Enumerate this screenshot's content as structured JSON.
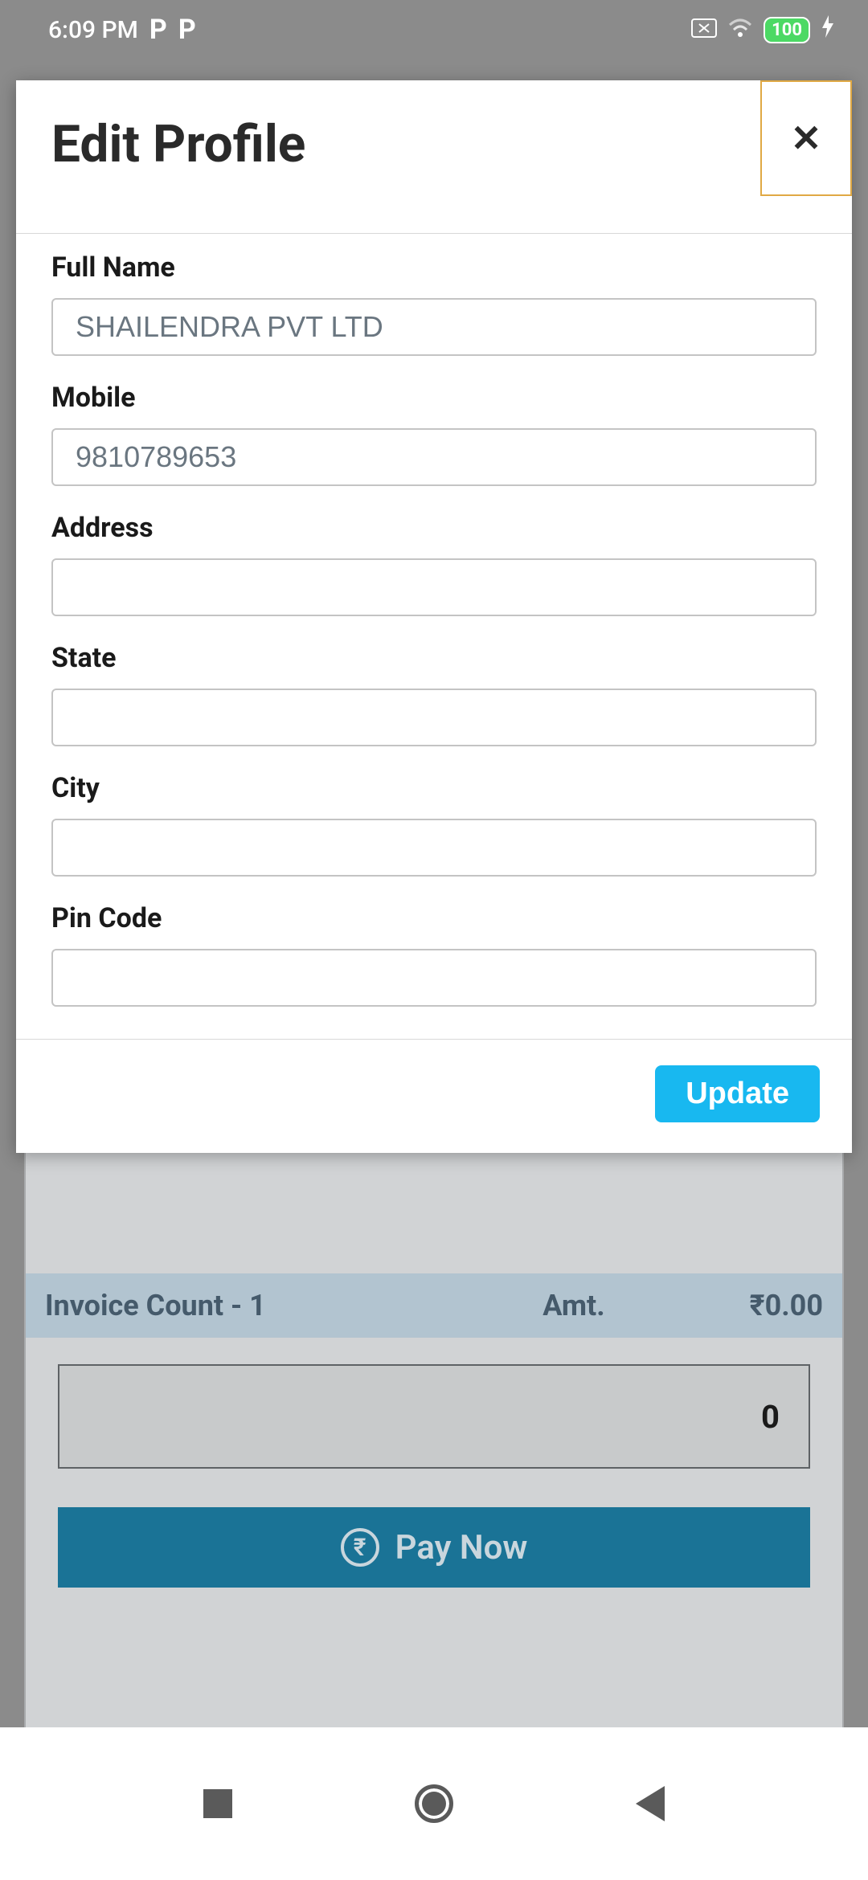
{
  "status": {
    "time": "6:09 PM",
    "battery": "100"
  },
  "modal": {
    "title": "Edit Profile",
    "close_glyph": "✕",
    "fields": {
      "full_name": {
        "label": "Full Name",
        "value": "SHAILENDRA PVT LTD"
      },
      "mobile": {
        "label": "Mobile",
        "value": "9810789653"
      },
      "address": {
        "label": "Address",
        "value": ""
      },
      "state": {
        "label": "State",
        "value": ""
      },
      "city": {
        "label": "City",
        "value": ""
      },
      "pin_code": {
        "label": "Pin Code",
        "value": ""
      }
    },
    "update_label": "Update"
  },
  "background": {
    "invoice_count_label": "Invoice Count - 1",
    "amt_label": "Amt.",
    "amt_value": "₹0.00",
    "payment_value": "0",
    "pay_now_label": "Pay Now",
    "rupee_glyph": "₹"
  }
}
